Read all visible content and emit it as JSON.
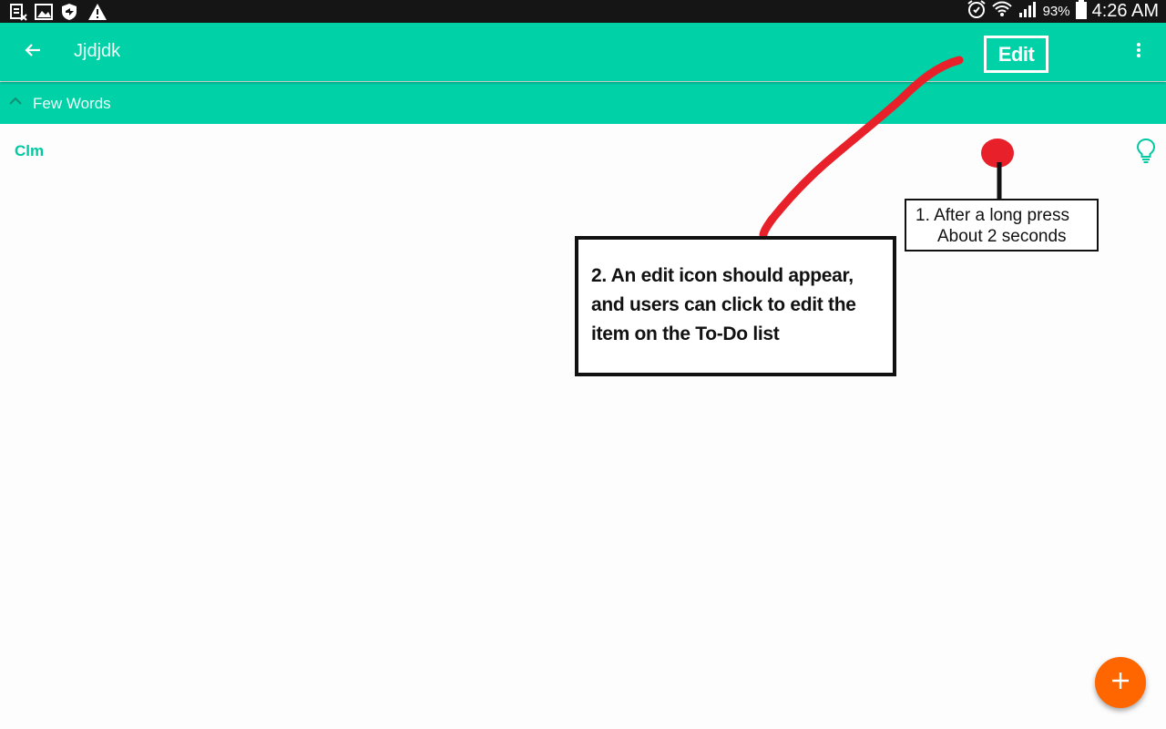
{
  "status_bar": {
    "notification_icons": [
      "sim-card-icon",
      "image-icon",
      "shield-icon",
      "warning-icon"
    ],
    "system_icons": [
      "alarm-icon",
      "wifi-icon",
      "signal-icon",
      "battery-icon"
    ],
    "battery_percent": "93%",
    "time": "4:26 AM"
  },
  "app_bar": {
    "back_icon": "arrow-left-icon",
    "title": "Jjdjdk",
    "edit_label": "Edit",
    "overflow_icon": "more-vertical-icon"
  },
  "section": {
    "chevron_icon": "chevron-up-icon",
    "title": "Few Words"
  },
  "list": {
    "items": [
      {
        "label": "Clm",
        "icon": "lightbulb-icon"
      }
    ]
  },
  "annotations": {
    "box1_line1": "1. After a long press",
    "box1_line2": "About 2 seconds",
    "box2_text": "2. An edit icon should appear, and users can click to edit the item on the To-Do list"
  },
  "fab": {
    "icon": "plus-icon"
  },
  "colors": {
    "accent": "#00d1a7",
    "accent_text": "#00c9a2",
    "fab": "#ff6600",
    "annotation_red": "#e8202a",
    "status_bar": "#151515"
  }
}
